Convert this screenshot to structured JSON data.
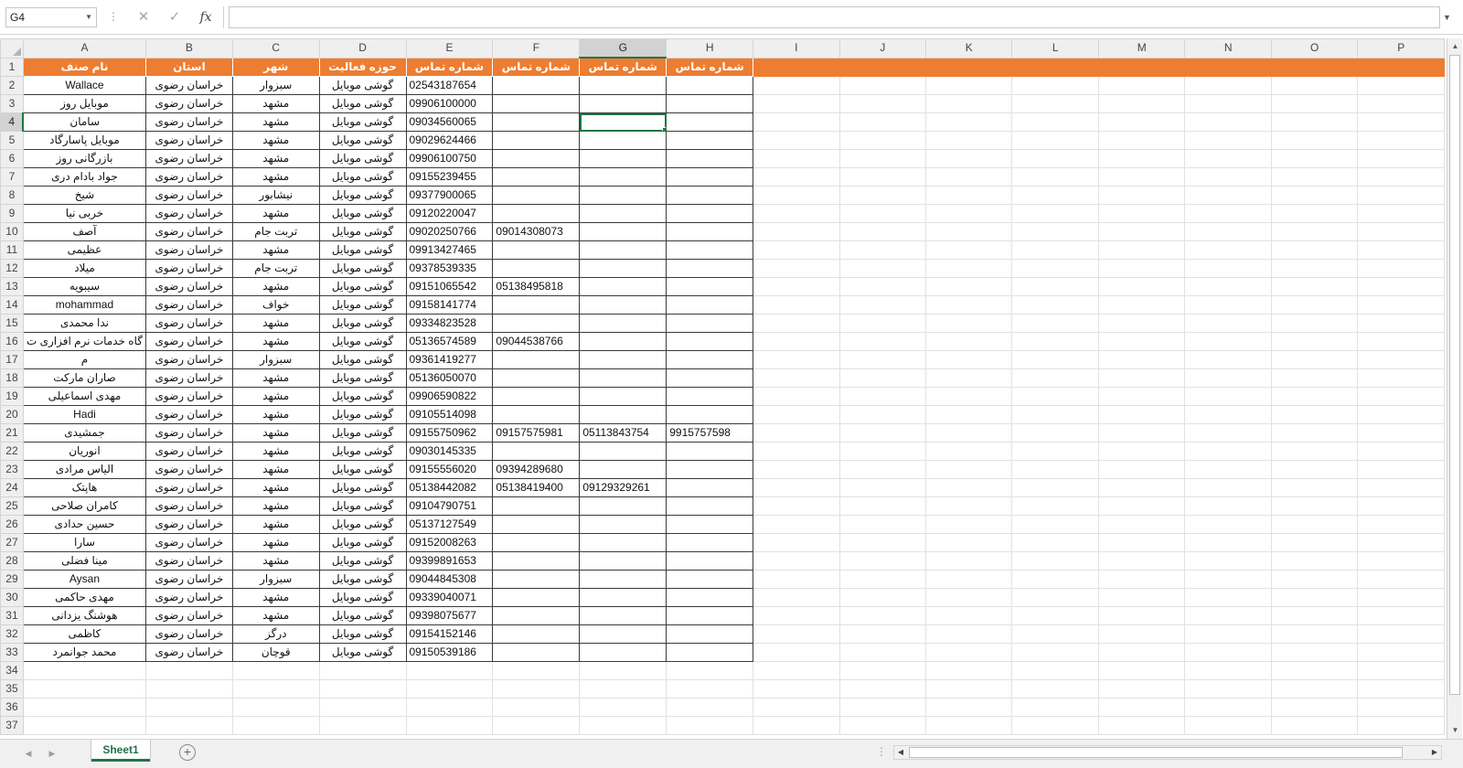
{
  "formula_bar": {
    "name_box": "G4",
    "cancel_icon": "✕",
    "enter_icon": "✓",
    "fx_label": "fx",
    "formula": ""
  },
  "columns": [
    "A",
    "B",
    "C",
    "D",
    "E",
    "F",
    "G",
    "H",
    "I",
    "J",
    "K",
    "L",
    "M",
    "N",
    "O",
    "P"
  ],
  "selected_cell": {
    "column": "G",
    "row": 4
  },
  "header_row": [
    "نام صنف",
    "استان",
    "شهر",
    "حوزه فعالیت",
    "شماره تماس",
    "شماره تماس",
    "شماره تماس",
    "شماره تماس"
  ],
  "rows": [
    [
      "Wallace",
      "خراسان رضوی",
      "سبزوار",
      "گوشی موبایل",
      "02543187654",
      "",
      "",
      ""
    ],
    [
      "موبایل روز",
      "خراسان رضوی",
      "مشهد",
      "گوشی موبایل",
      "09906100000",
      "",
      "",
      ""
    ],
    [
      "سامان",
      "خراسان رضوی",
      "مشهد",
      "گوشی موبایل",
      "09034560065",
      "",
      "",
      ""
    ],
    [
      "موبایل پاسارگاد",
      "خراسان رضوی",
      "مشهد",
      "گوشی موبایل",
      "09029624466",
      "",
      "",
      ""
    ],
    [
      "بازرگانی روز",
      "خراسان رضوی",
      "مشهد",
      "گوشی موبایل",
      "09906100750",
      "",
      "",
      ""
    ],
    [
      "جواد بادام دری",
      "خراسان رضوی",
      "مشهد",
      "گوشی موبایل",
      "09155239455",
      "",
      "",
      ""
    ],
    [
      "شیخ",
      "خراسان رضوی",
      "نیشابور",
      "گوشی موبایل",
      "09377900065",
      "",
      "",
      ""
    ],
    [
      "خربی نیا",
      "خراسان رضوی",
      "مشهد",
      "گوشی موبایل",
      "09120220047",
      "",
      "",
      ""
    ],
    [
      "آصف",
      "خراسان رضوی",
      "تربت جام",
      "گوشی موبایل",
      "09020250766",
      "09014308073",
      "",
      ""
    ],
    [
      "عظیمی",
      "خراسان رضوی",
      "مشهد",
      "گوشی موبایل",
      "09913427465",
      "",
      "",
      ""
    ],
    [
      "میلاد",
      "خراسان رضوی",
      "تربت جام",
      "گوشی موبایل",
      "09378539335",
      "",
      "",
      ""
    ],
    [
      "سیبویه",
      "خراسان رضوی",
      "مشهد",
      "گوشی موبایل",
      "09151065542",
      "05138495818",
      "",
      ""
    ],
    [
      "mohammad",
      "خراسان رضوی",
      "خواف",
      "گوشی موبایل",
      "09158141774",
      "",
      "",
      ""
    ],
    [
      "ندا محمدی",
      "خراسان رضوی",
      "مشهد",
      "گوشی موبایل",
      "09334823528",
      "",
      "",
      ""
    ],
    [
      "گاه خدمات نرم افزاری ت",
      "خراسان رضوی",
      "مشهد",
      "گوشی موبایل",
      "05136574589",
      "09044538766",
      "",
      ""
    ],
    [
      "م",
      "خراسان رضوی",
      "سبزوار",
      "گوشی موبایل",
      "09361419277",
      "",
      "",
      ""
    ],
    [
      "صاران مارکت",
      "خراسان رضوی",
      "مشهد",
      "گوشی موبایل",
      "05136050070",
      "",
      "",
      ""
    ],
    [
      "مهدی اسماعیلی",
      "خراسان رضوی",
      "مشهد",
      "گوشی موبایل",
      "09906590822",
      "",
      "",
      ""
    ],
    [
      "Hadi",
      "خراسان رضوی",
      "مشهد",
      "گوشی موبایل",
      "09105514098",
      "",
      "",
      ""
    ],
    [
      "جمشیدی",
      "خراسان رضوی",
      "مشهد",
      "گوشی موبایل",
      "09155750962",
      "09157575981",
      "05113843754",
      "9915757598"
    ],
    [
      "انوریان",
      "خراسان رضوی",
      "مشهد",
      "گوشی موبایل",
      "09030145335",
      "",
      "",
      ""
    ],
    [
      "الیاس مرادی",
      "خراسان رضوی",
      "مشهد",
      "گوشی موبایل",
      "09155556020",
      "09394289680",
      "",
      ""
    ],
    [
      "هاپتک",
      "خراسان رضوی",
      "مشهد",
      "گوشی موبایل",
      "05138442082",
      "05138419400",
      "09129329261",
      ""
    ],
    [
      "کامران صلاحی",
      "خراسان رضوی",
      "مشهد",
      "گوشی موبایل",
      "09104790751",
      "",
      "",
      ""
    ],
    [
      "حسین حدادی",
      "خراسان رضوی",
      "مشهد",
      "گوشی موبایل",
      "05137127549",
      "",
      "",
      ""
    ],
    [
      "سارا",
      "خراسان رضوی",
      "مشهد",
      "گوشی موبایل",
      "09152008263",
      "",
      "",
      ""
    ],
    [
      "مینا فضلی",
      "خراسان رضوی",
      "مشهد",
      "گوشی موبایل",
      "09399891653",
      "",
      "",
      ""
    ],
    [
      "Aysan",
      "خراسان رضوی",
      "سبزوار",
      "گوشی موبایل",
      "09044845308",
      "",
      "",
      ""
    ],
    [
      "مهدی حاکمی",
      "خراسان رضوی",
      "مشهد",
      "گوشی موبایل",
      "09339040071",
      "",
      "",
      ""
    ],
    [
      "هوشنگ یزدانی",
      "خراسان رضوی",
      "مشهد",
      "گوشی موبایل",
      "09398075677",
      "",
      "",
      ""
    ],
    [
      "کاظمی",
      "خراسان رضوی",
      "درگز",
      "گوشی موبایل",
      "09154152146",
      "",
      "",
      ""
    ],
    [
      "محمد جوانمرد",
      "خراسان رضوی",
      "قوچان",
      "گوشی موبایل",
      "09150539186",
      "",
      "",
      ""
    ]
  ],
  "empty_row_numbers": [
    34,
    35,
    36,
    37
  ],
  "sheet_tabs": [
    "Sheet1"
  ],
  "add_sheet_label": "+",
  "colors": {
    "header_fill": "#ed7d31",
    "accent": "#217346"
  }
}
